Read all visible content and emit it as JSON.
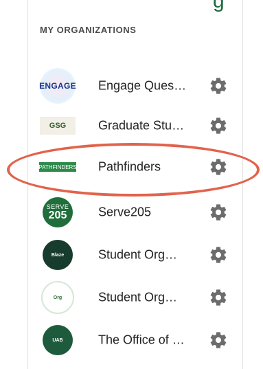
{
  "header": {
    "partial_text": "g"
  },
  "section": {
    "title": "MY ORGANIZATIONS"
  },
  "organizations": [
    {
      "name": "Engage Ques…",
      "logo_text": "ENGAGE",
      "logo": "engage"
    },
    {
      "name": "Graduate Stu…",
      "logo_text": "GSG",
      "logo": "gsg"
    },
    {
      "name": "Pathfinders",
      "logo_text": "PATHFINDERS",
      "logo": "pathfinders",
      "highlighted": true
    },
    {
      "name": "Serve205",
      "logo_text_1": "SERVE",
      "logo_text_2": "205",
      "logo": "serve205"
    },
    {
      "name": "Student Org…",
      "logo_text": "Blaze",
      "logo": "student-org-dark"
    },
    {
      "name": "Student Org…",
      "logo_text": "Org",
      "logo": "student-org-light"
    },
    {
      "name": "The Office of …",
      "logo_text": "UAB",
      "logo": "office"
    }
  ],
  "colors": {
    "accent": "#1e6b42",
    "highlight": "#e2634c",
    "gear": "#6c6c6c"
  }
}
